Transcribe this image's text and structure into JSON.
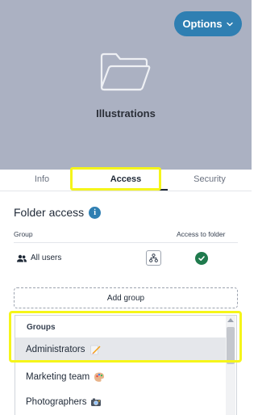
{
  "header": {
    "options_label": "Options",
    "folder_title": "Illustrations"
  },
  "tabs": [
    {
      "label": "Info",
      "active": false
    },
    {
      "label": "Access",
      "active": true
    },
    {
      "label": "Security",
      "active": false
    }
  ],
  "folder_access": {
    "title": "Folder access",
    "column_group": "Group",
    "column_access": "Access to folder",
    "rows": [
      {
        "name": "All users",
        "has_access": true
      }
    ],
    "add_group_label": "Add group"
  },
  "dropdown": {
    "header": "Groups",
    "items": [
      {
        "label": "Administrators",
        "icon": "pencil-emoji",
        "selected": true
      },
      {
        "label": "Marketing team",
        "icon": "palette-emoji",
        "selected": false
      },
      {
        "label": "Photographers",
        "icon": "camera-emoji",
        "selected": false
      }
    ]
  },
  "colors": {
    "hero_bg": "#abb1c2",
    "accent": "#2f7fb2",
    "success": "#1f7a4d",
    "highlight": "#f5f51a"
  }
}
